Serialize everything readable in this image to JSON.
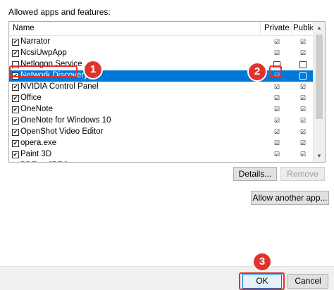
{
  "heading": "Allowed apps and features:",
  "columns": {
    "name": "Name",
    "private": "Private",
    "public": "Public"
  },
  "rows": [
    {
      "label": "Narrator",
      "enabled": true,
      "private": true,
      "public": true
    },
    {
      "label": "NcsiUwpApp",
      "enabled": true,
      "private": true,
      "public": true
    },
    {
      "label": "Netlogon Service",
      "enabled": false,
      "private": false,
      "public": false
    },
    {
      "label": "Network Discovery",
      "enabled": true,
      "private": true,
      "public": false,
      "selected": true
    },
    {
      "label": "NVIDIA Control Panel",
      "enabled": true,
      "private": true,
      "public": true
    },
    {
      "label": "Office",
      "enabled": true,
      "private": true,
      "public": true
    },
    {
      "label": "OneNote",
      "enabled": true,
      "private": true,
      "public": true
    },
    {
      "label": "OneNote for Windows 10",
      "enabled": true,
      "private": true,
      "public": true
    },
    {
      "label": "OpenShot Video Editor",
      "enabled": true,
      "private": true,
      "public": true
    },
    {
      "label": "opera.exe",
      "enabled": true,
      "private": true,
      "public": true
    },
    {
      "label": "Paint 3D",
      "enabled": true,
      "private": true,
      "public": true
    },
    {
      "label": "PDF to JPEG",
      "enabled": true,
      "private": true,
      "public": true
    }
  ],
  "buttons": {
    "details": "Details...",
    "remove": "Remove",
    "allow_another": "Allow another app...",
    "ok": "OK",
    "cancel": "Cancel"
  },
  "callouts": {
    "one": "1",
    "two": "2",
    "three": "3"
  },
  "colors": {
    "selection": "#0078d7",
    "callout": "#e0332d"
  }
}
